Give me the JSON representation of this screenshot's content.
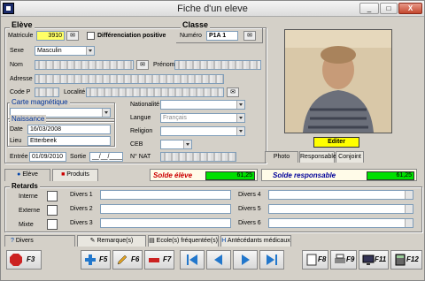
{
  "window": {
    "title": "Fiche d'un eleve",
    "min": "_",
    "max": "□",
    "close": "X"
  },
  "eleve": {
    "group_title": "Elève",
    "matricule_label": "Matricule",
    "matricule": "3910",
    "diff_label": "Différenciation positive",
    "sexe_label": "Sexe",
    "sexe": "Masculin",
    "nom_label": "Nom",
    "prenom_label": "Prénom",
    "adresse_label": "Adresse",
    "codep_label": "Code P",
    "localite_label": "Localité",
    "carte_label": "Carte magnétique",
    "naissance_label": "Naissance",
    "date_label": "Date",
    "date": "16/03/2008",
    "lieu_label": "Lieu",
    "lieu": "Etterbeek",
    "entree_label": "Entrée",
    "entree": "01/09/2010",
    "sortie_label": "Sortie",
    "sortie": "__/__/____",
    "nationalite_label": "Nationalité",
    "langue_label": "Langue",
    "langue": "Français",
    "religion_label": "Religion",
    "ceb_label": "CEB",
    "nnat_label": "N° NAT"
  },
  "classe": {
    "group_title": "Classe",
    "numero_label": "Numéro",
    "numero": "P1A 1"
  },
  "photo": {
    "editer": "Editer",
    "tabs": [
      "Photo",
      "Responsable",
      "Conjoint"
    ]
  },
  "tabs_top": [
    "Elève",
    "Produits"
  ],
  "solde": {
    "eleve_label": "Solde élève",
    "eleve_value": "61,25",
    "resp_label": "Solde responsable",
    "resp_value": "61,25"
  },
  "colors": {
    "solde_eleve": "#cc0000",
    "solde_resp": "#000099",
    "solde_green": "#00e000",
    "editer_yellow": "#ffff00"
  },
  "retards": {
    "group_title": "Retards",
    "interne": "Interne",
    "externe": "Externe",
    "mixte": "Mixte"
  },
  "divers": [
    "Divers 1",
    "Divers 2",
    "Divers 3",
    "Divers 4",
    "Divers 5",
    "Divers 6"
  ],
  "tabs_bottom": [
    "Divers",
    "Remarque(s)",
    "Ecole(s) fréquentée(s)",
    "Antécédants médicaux"
  ],
  "toolbar": {
    "f3": "F3",
    "f5": "F5",
    "f6": "F6",
    "f7": "F7",
    "f8": "F8",
    "f9": "F9",
    "f11": "F11",
    "f12": "F12"
  }
}
